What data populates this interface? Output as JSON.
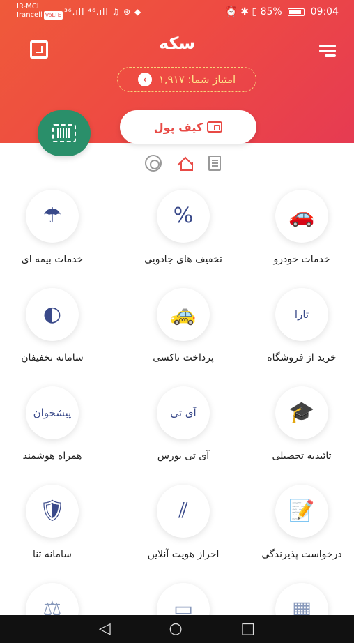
{
  "status_bar": {
    "carrier_1": "IR-MCI",
    "carrier_2": "Irancell",
    "volte": "VoLTE",
    "signals": "³⁶.ıll ⁴⁶.ıll ♫ ⊛ ◆",
    "battery_percent": "85%",
    "time": "09:04"
  },
  "app": {
    "title": "سکه"
  },
  "points": {
    "label": "امتیاز شما: ۱,۹۱۷"
  },
  "wallet": {
    "label": "کیف پول"
  },
  "services": [
    {
      "label": "خدمات خودرو",
      "icon": "car-service-icon",
      "glyph": "🚗"
    },
    {
      "label": "تخفیف های جادویی",
      "icon": "discount-badge-icon",
      "glyph": "%"
    },
    {
      "label": "خدمات بیمه ای",
      "icon": "insurance-umbrella-icon",
      "glyph": "☂"
    },
    {
      "label": "خرید از فروشگاه",
      "icon": "tara-logo-icon",
      "glyph": "تارا"
    },
    {
      "label": "پرداخت تاکسی",
      "icon": "taxi-icon",
      "glyph": "🚕"
    },
    {
      "label": "سامانه تخفیفان",
      "icon": "takhfifan-logo-icon",
      "glyph": "◐"
    },
    {
      "label": "تائیدیه تحصیلی",
      "icon": "graduation-cap-icon",
      "glyph": "🎓"
    },
    {
      "label": "آی تی بورس",
      "icon": "itbourse-logo-icon",
      "glyph": "آی تی"
    },
    {
      "label": "همراه هوشمند",
      "icon": "hamrah-hooshmand-logo-icon",
      "glyph": "پیشخوان"
    },
    {
      "label": "درخواست پذیرندگی",
      "icon": "document-pen-icon",
      "glyph": "📝"
    },
    {
      "label": "احراز هویت آنلاین",
      "icon": "online-identity-icon",
      "glyph": "⫽"
    },
    {
      "label": "سامانه ثنا",
      "icon": "sana-shield-icon",
      "glyph": "🛡"
    }
  ],
  "partial_row": [
    {
      "icon": "calendar-icon",
      "glyph": "▦"
    },
    {
      "icon": "card-icon",
      "glyph": "▭"
    },
    {
      "icon": "scale-icon",
      "glyph": "⚖"
    }
  ],
  "nav": {
    "back": "◁",
    "home": "○",
    "recent": "□"
  },
  "colors": {
    "header_start": "#ef5a3a",
    "header_end": "#e63b52",
    "accent": "#e84a45",
    "barcode_green": "#2a8f6a"
  }
}
